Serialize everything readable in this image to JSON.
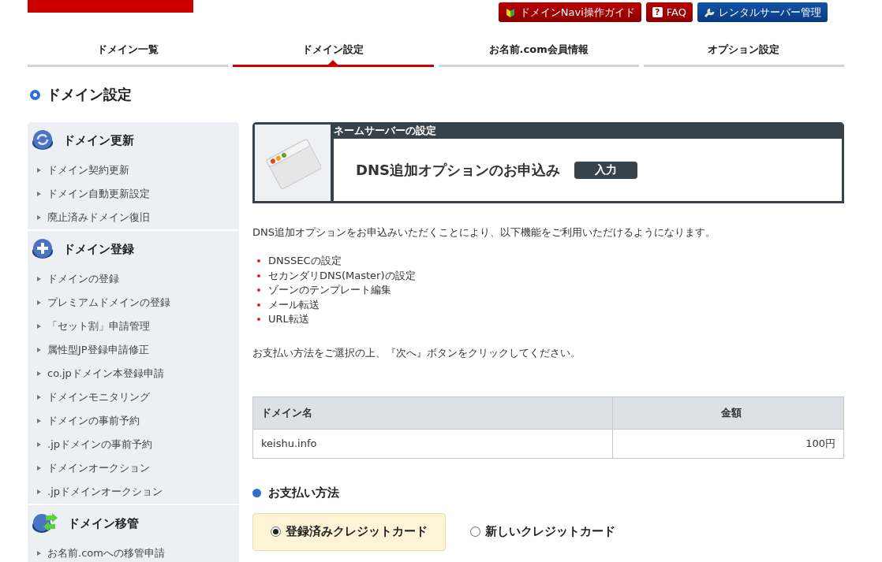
{
  "header": {
    "links": [
      {
        "label": "ドメインNavi操作ガイド",
        "kind": "guide"
      },
      {
        "label": "FAQ",
        "kind": "faq",
        "icon": "?"
      },
      {
        "label": "レンタルサーバー管理",
        "kind": "server"
      }
    ]
  },
  "tabs": [
    {
      "label": "ドメイン一覧",
      "selected": false
    },
    {
      "label": "ドメイン設定",
      "selected": true
    },
    {
      "label": "お名前.com会員情報",
      "selected": false
    },
    {
      "label": "オプション設定",
      "selected": false
    }
  ],
  "page_title": "ドメイン設定",
  "sidebar": {
    "sections": [
      {
        "title": "ドメイン更新",
        "kind": "renew",
        "items": [
          "ドメイン契約更新",
          "ドメイン自動更新設定",
          "廃止済みドメイン復旧"
        ]
      },
      {
        "title": "ドメイン登録",
        "kind": "register",
        "items": [
          "ドメインの登録",
          "プレミアムドメインの登録",
          "「セット割」申請管理",
          "属性型JP登録申請修正",
          "co.jpドメイン本登録申請",
          "ドメインモニタリング",
          "ドメインの事前予約",
          ".jpドメインの事前予約",
          "ドメインオークション",
          ".jpドメインオークション"
        ]
      },
      {
        "title": "ドメイン移管",
        "kind": "transfer",
        "items": [
          "お名前.comへの移管申請"
        ]
      }
    ]
  },
  "panel": {
    "caption": "ネームサーバーの設定",
    "title": "DNS追加オプションのお申込み",
    "step": "入力"
  },
  "intro": "DNS追加オプションをお申込みいただくことにより、以下機能をご利用いただけるようになります。",
  "features": [
    "DNSSECの設定",
    "セカンダリDNS(Master)の設定",
    "ゾーンのテンプレート編集",
    "メール転送",
    "URL転送"
  ],
  "instruction": "お支払い方法をご選択の上、『次へ』ボタンをクリックしてください。",
  "table": {
    "columns": [
      "ドメイン名",
      "金額"
    ],
    "rows": [
      [
        "keishu.info",
        "100円"
      ]
    ]
  },
  "payment": {
    "title": "お支払い方法",
    "options": [
      {
        "label": "登録済みクレジットカード",
        "selected": true
      },
      {
        "label": "新しいクレジットカード",
        "selected": false
      }
    ]
  }
}
